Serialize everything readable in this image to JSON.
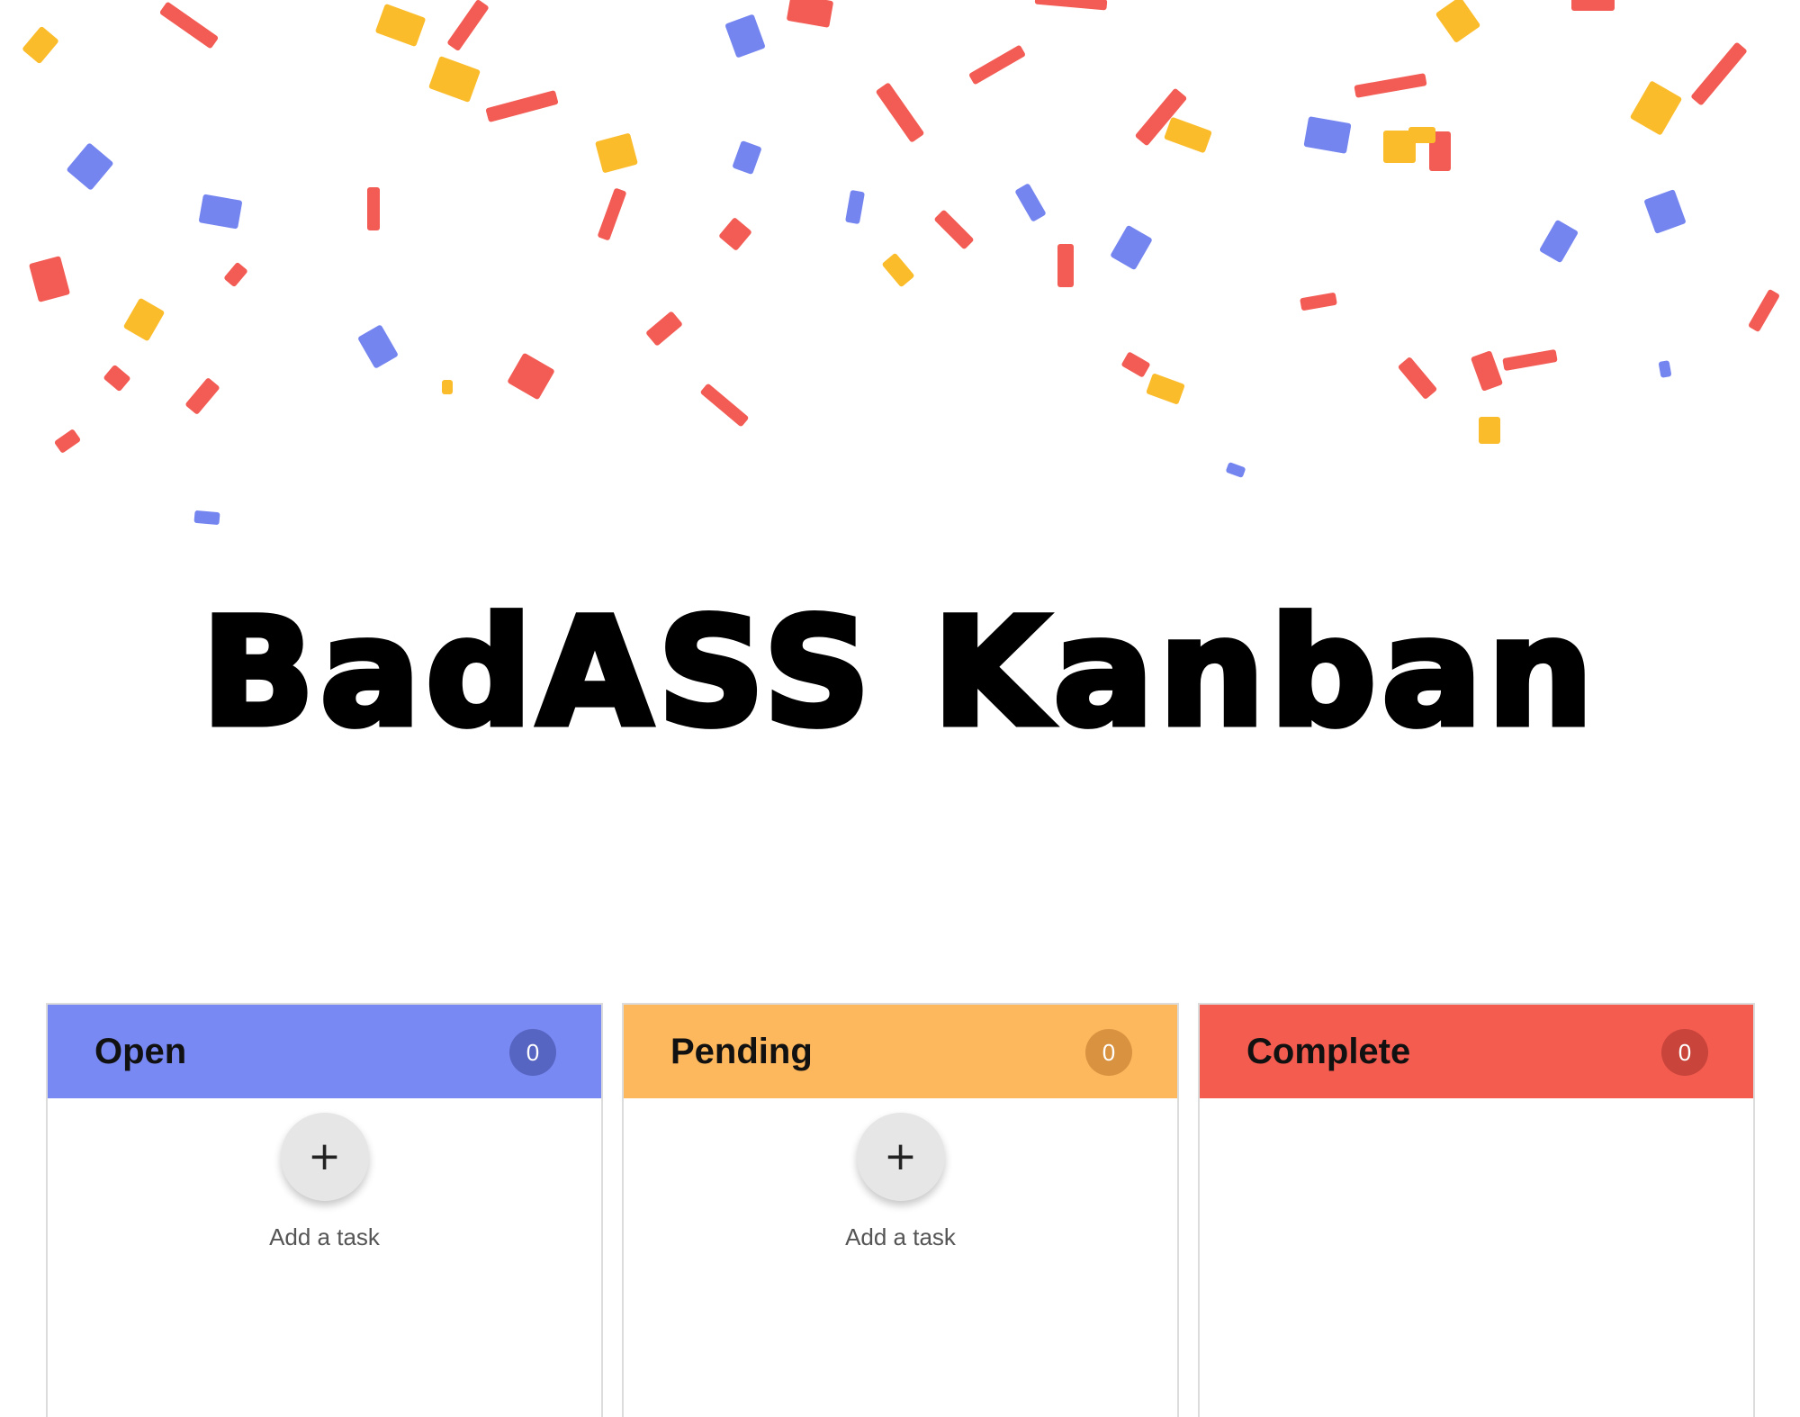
{
  "title": "BadASS Kanban",
  "colors": {
    "confetti": [
      "#f25c54",
      "#fbbc2c",
      "#7585f0"
    ]
  },
  "columns": [
    {
      "name": "Open",
      "count": "0",
      "header_color": "#7989f3",
      "badge_color": "#5664c2",
      "add_icon": "plus-icon",
      "add_symbol": "+",
      "add_label": "Add a task"
    },
    {
      "name": "Pending",
      "count": "0",
      "header_color": "#fdb75d",
      "badge_color": "#d99240",
      "add_icon": "plus-icon",
      "add_symbol": "+",
      "add_label": "Add a task"
    },
    {
      "name": "Complete",
      "count": "0",
      "header_color": "#f55c50",
      "badge_color": "#c9443b"
    }
  ]
}
